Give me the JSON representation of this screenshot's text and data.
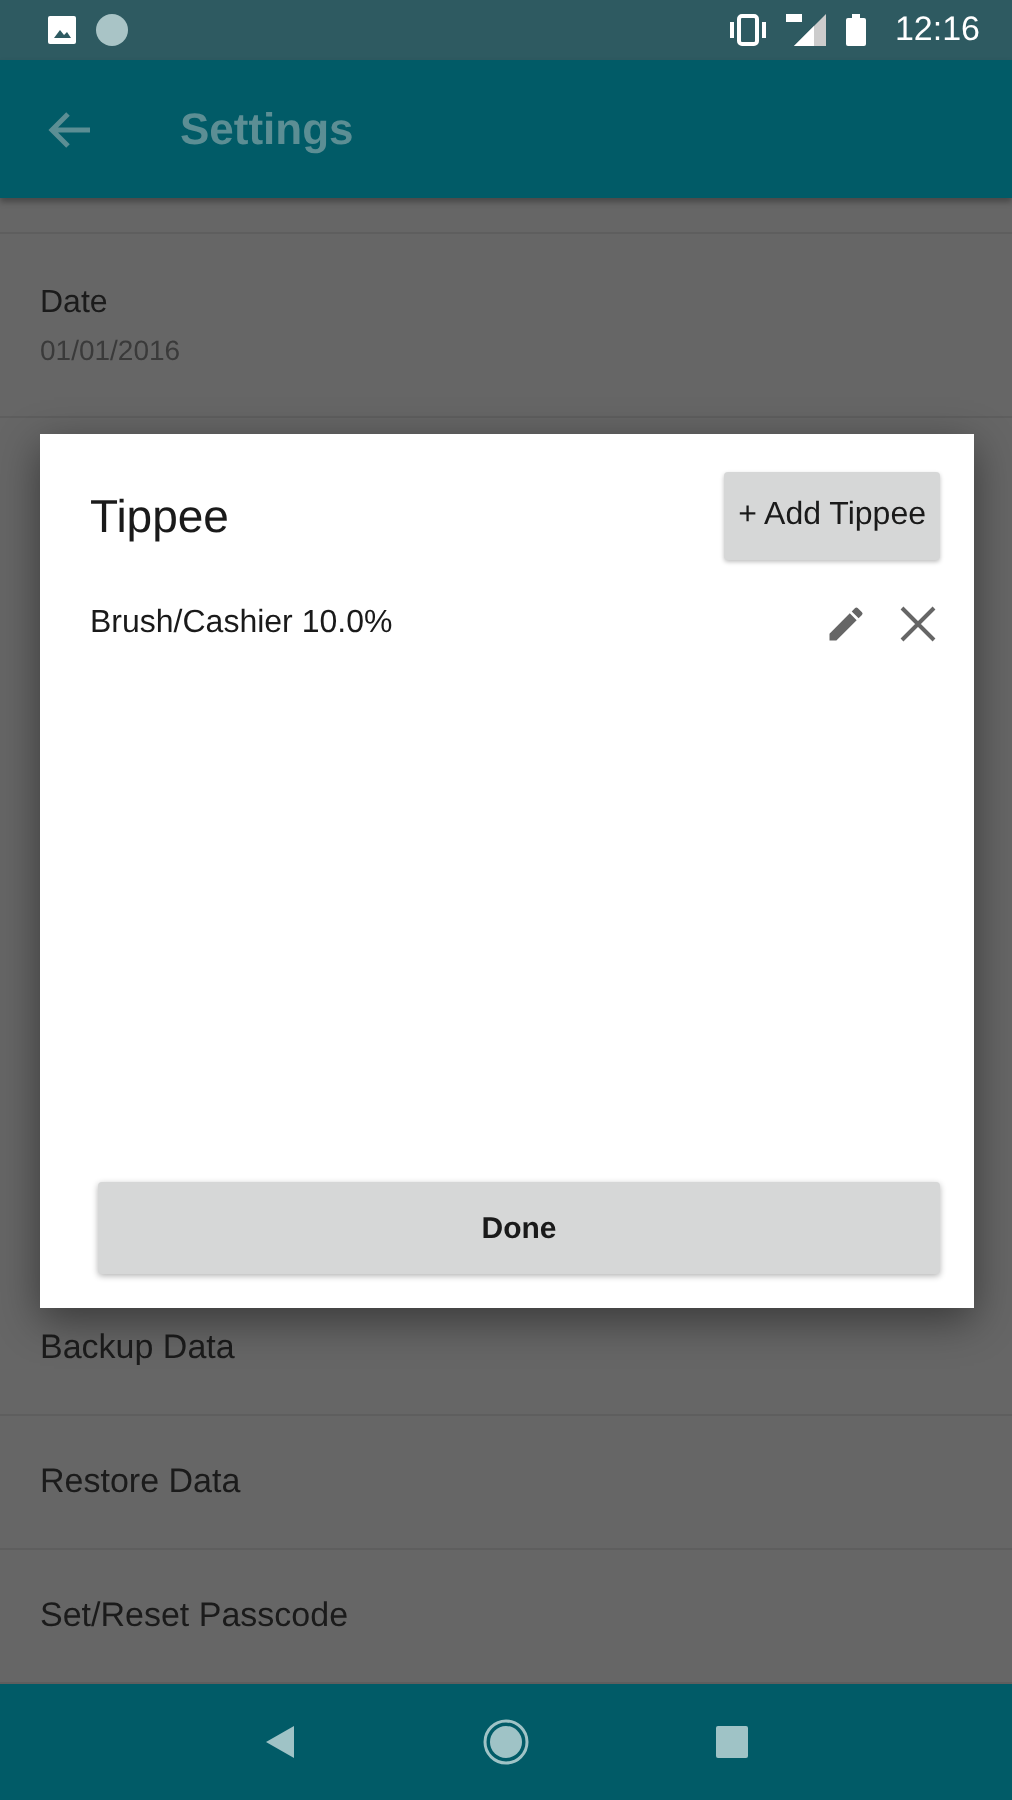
{
  "status_bar": {
    "time": "12:16"
  },
  "app_bar": {
    "title": "Settings"
  },
  "settings_top": [
    {
      "label": "Date",
      "value": "01/01/2016"
    }
  ],
  "settings_bottom": [
    {
      "label": "Backup Data"
    },
    {
      "label": "Restore Data"
    },
    {
      "label": "Set/Reset Passcode"
    }
  ],
  "dialog": {
    "title": "Tippee",
    "add_button": "+ Add Tippee",
    "items": [
      {
        "label": "Brush/Cashier 10.0%"
      }
    ],
    "done_button": "Done"
  }
}
